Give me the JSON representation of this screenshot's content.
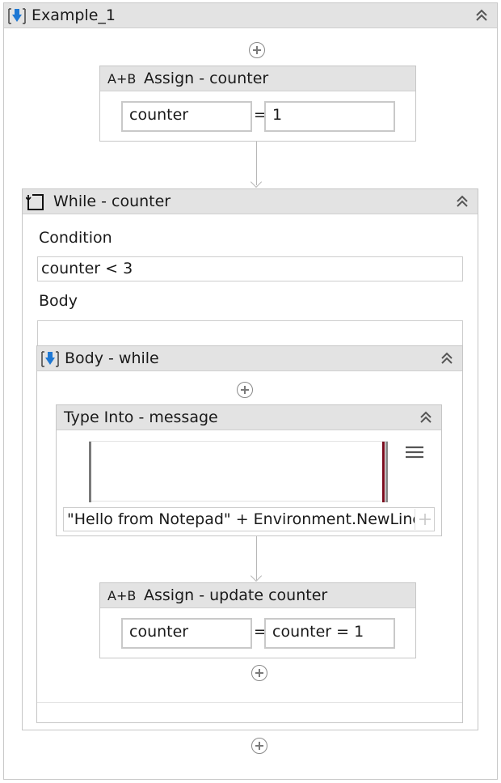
{
  "example": {
    "title": "Example_1"
  },
  "assign1": {
    "badge": "A+B",
    "title": "Assign - counter",
    "to": "counter",
    "eq": "=",
    "value": "1"
  },
  "while": {
    "title": "While - counter",
    "condition_label": "Condition",
    "condition": "counter < 3",
    "body_label": "Body"
  },
  "body_seq": {
    "title": "Body - while"
  },
  "type_into": {
    "title": "Type Into - message",
    "text": "\"Hello from Notepad\" + Environment.NewLine"
  },
  "assign2": {
    "badge": "A+B",
    "title": "Assign -  update counter",
    "to": "counter",
    "eq": "=",
    "value": "counter = 1"
  },
  "colors": {
    "header_bg": "#e3e3e3",
    "icon_blue": "#1e78d4",
    "marker_red": "#7a0c1e"
  }
}
